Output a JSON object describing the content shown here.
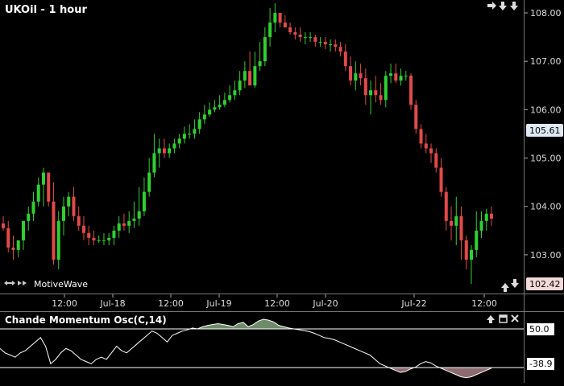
{
  "chart_title": "UKOil - 1 hour",
  "brand": "MotiveWave",
  "osc_title": "Chande Momentum Osc(C,14)",
  "colors": {
    "up": "#2fd02f",
    "down": "#e24a4a",
    "osc_line": "#ffffff",
    "osc_fill_pos": "#6f8c6a",
    "osc_fill_neg": "#8c6a6f"
  },
  "icons": {
    "top_right": [
      "arrow-right-icon",
      "arrow-down-icon",
      "arrow-down-icon"
    ],
    "bottom_nav": [
      "arrow-left-right-icon",
      "double-arrow-right-icon"
    ],
    "bottom_right": [
      "arrow-up-icon",
      "arrow-down-icon"
    ],
    "osc_controls": [
      "arrow-up-icon",
      "minimize-icon",
      "close-icon"
    ]
  },
  "price_axis": {
    "labels": [
      "108.00",
      "107.00",
      "106.00",
      "105.00",
      "104.00",
      "103.00"
    ],
    "ylim": [
      102.25,
      108.2
    ]
  },
  "current_price_tag": "105.61",
  "low_price_tag": "102.42",
  "time_axis": {
    "labels": [
      "12:00",
      "Jul-18",
      "12:00",
      "Jul-19",
      "12:00",
      "Jul-20",
      "Jul-22",
      "12:00"
    ]
  },
  "osc_axis": {
    "upper": "50.0",
    "lower": "-38.9"
  },
  "chart_data": [
    {
      "type": "candlestick",
      "title": "UKOil - 1 hour",
      "ylim": [
        102.25,
        108.2
      ],
      "open": [
        103.65,
        103.55,
        103.15,
        103.1,
        103.3,
        103.7,
        103.85,
        104.1,
        104.45,
        104.7,
        104.1,
        102.9,
        103.7,
        104.0,
        104.2,
        103.8,
        103.6,
        103.45,
        103.35,
        103.3,
        103.3,
        103.3,
        103.35,
        103.5,
        103.65,
        103.6,
        103.7,
        103.75,
        103.9,
        104.3,
        104.7,
        105.1,
        105.2,
        105.1,
        105.2,
        105.3,
        105.4,
        105.5,
        105.5,
        105.6,
        105.8,
        105.9,
        106.0,
        106.05,
        106.1,
        106.2,
        106.3,
        106.4,
        106.6,
        106.8,
        106.5,
        106.9,
        107.0,
        107.5,
        107.8,
        108.0,
        107.8,
        107.7,
        107.6,
        107.55,
        107.5,
        107.5,
        107.5,
        107.4,
        107.4,
        107.35,
        107.35,
        107.3,
        107.2,
        106.9,
        106.6,
        106.75,
        106.65,
        106.3,
        106.4,
        106.3,
        106.2,
        106.7,
        106.75,
        106.6,
        106.7,
        106.7,
        106.1,
        105.6,
        105.3,
        105.2,
        105.1,
        104.8,
        104.3,
        103.7,
        103.6,
        103.8,
        103.3,
        102.9,
        103.1,
        103.5,
        103.7,
        103.85
      ],
      "high": [
        103.8,
        103.7,
        103.4,
        103.3,
        103.7,
        104.0,
        104.3,
        104.6,
        104.8,
        104.7,
        104.5,
        103.9,
        104.2,
        104.3,
        104.4,
        104.0,
        103.8,
        103.6,
        103.5,
        103.4,
        103.45,
        103.45,
        103.6,
        103.8,
        103.85,
        103.9,
        104.1,
        104.4,
        104.6,
        105.0,
        105.5,
        105.4,
        105.4,
        105.3,
        105.4,
        105.5,
        105.65,
        105.7,
        105.8,
        105.95,
        106.1,
        106.15,
        106.2,
        106.3,
        106.35,
        106.5,
        106.6,
        106.8,
        107.0,
        107.2,
        107.2,
        107.4,
        107.7,
        108.1,
        108.2,
        108.0,
        107.95,
        107.8,
        107.7,
        107.7,
        107.6,
        107.6,
        107.55,
        107.5,
        107.5,
        107.45,
        107.45,
        107.4,
        107.35,
        107.1,
        107.0,
        106.95,
        106.85,
        106.6,
        106.7,
        106.55,
        106.8,
        106.95,
        106.95,
        106.85,
        106.8,
        106.75,
        106.2,
        105.7,
        105.5,
        105.3,
        105.2,
        105.0,
        104.4,
        104.0,
        104.2,
        104.0,
        103.4,
        103.2,
        103.9,
        103.9,
        103.95,
        104.0
      ],
      "low": [
        103.5,
        103.05,
        102.9,
        102.95,
        103.1,
        103.5,
        103.7,
        104.0,
        104.0,
        104.0,
        102.8,
        102.7,
        103.4,
        103.8,
        103.7,
        103.5,
        103.3,
        103.2,
        103.2,
        103.25,
        103.2,
        103.2,
        103.2,
        103.35,
        103.5,
        103.45,
        103.55,
        103.6,
        103.8,
        104.2,
        104.6,
        104.8,
        105.0,
        105.0,
        105.1,
        105.2,
        105.3,
        105.4,
        105.4,
        105.5,
        105.7,
        105.85,
        105.95,
        106.0,
        106.05,
        106.15,
        106.2,
        106.3,
        106.45,
        106.6,
        106.45,
        106.8,
        106.9,
        107.3,
        107.6,
        107.7,
        107.7,
        107.55,
        107.45,
        107.4,
        107.35,
        107.4,
        107.3,
        107.3,
        107.25,
        107.2,
        107.2,
        107.1,
        106.8,
        106.5,
        106.4,
        106.5,
        106.1,
        105.9,
        106.15,
        106.1,
        106.05,
        106.55,
        106.55,
        106.5,
        106.6,
        106.0,
        105.5,
        105.2,
        105.1,
        104.9,
        104.7,
        104.2,
        103.5,
        103.3,
        103.2,
        102.9,
        102.7,
        102.4,
        102.95,
        103.35,
        103.5,
        103.6
      ],
      "close": [
        103.55,
        103.15,
        103.1,
        103.3,
        103.7,
        103.85,
        104.1,
        104.45,
        104.7,
        104.1,
        102.9,
        103.7,
        104.0,
        104.2,
        103.8,
        103.6,
        103.45,
        103.35,
        103.3,
        103.3,
        103.3,
        103.35,
        103.5,
        103.65,
        103.6,
        103.7,
        103.75,
        103.9,
        104.3,
        104.7,
        105.1,
        105.2,
        105.1,
        105.2,
        105.3,
        105.4,
        105.5,
        105.5,
        105.6,
        105.8,
        105.9,
        106.0,
        106.05,
        106.1,
        106.2,
        106.3,
        106.4,
        106.6,
        106.8,
        106.5,
        106.9,
        107.0,
        107.5,
        107.8,
        108.0,
        107.8,
        107.7,
        107.6,
        107.55,
        107.5,
        107.5,
        107.5,
        107.4,
        107.4,
        107.35,
        107.35,
        107.3,
        107.2,
        106.9,
        106.6,
        106.75,
        106.65,
        106.3,
        106.4,
        106.3,
        106.2,
        106.7,
        106.75,
        106.6,
        106.7,
        106.7,
        106.1,
        105.6,
        105.3,
        105.2,
        105.1,
        104.8,
        104.3,
        103.7,
        103.6,
        103.8,
        103.3,
        102.9,
        103.1,
        103.5,
        103.7,
        103.85,
        103.75
      ]
    },
    {
      "type": "line",
      "title": "Chande Momentum Osc(C,14)",
      "ylim": [
        -70,
        85
      ],
      "thresholds": [
        50.0,
        -38.9
      ],
      "values": [
        5,
        -5,
        -10,
        -15,
        -5,
        0,
        10,
        20,
        30,
        10,
        -30,
        -20,
        -5,
        5,
        0,
        -10,
        -20,
        -25,
        -30,
        -20,
        -15,
        -20,
        -5,
        10,
        0,
        -5,
        5,
        15,
        25,
        35,
        45,
        40,
        30,
        20,
        35,
        40,
        45,
        48,
        52,
        50,
        55,
        58,
        60,
        62,
        60,
        58,
        55,
        62,
        65,
        55,
        60,
        68,
        72,
        70,
        66,
        58,
        55,
        52,
        50,
        48,
        46,
        44,
        40,
        35,
        30,
        28,
        25,
        20,
        15,
        10,
        5,
        0,
        -5,
        -10,
        -20,
        -30,
        -35,
        -40,
        -45,
        -50,
        -48,
        -42,
        -38,
        -30,
        -25,
        -28,
        -35,
        -40,
        -45,
        -50,
        -55,
        -60,
        -62,
        -60,
        -55,
        -50,
        -45,
        -40
      ]
    }
  ]
}
